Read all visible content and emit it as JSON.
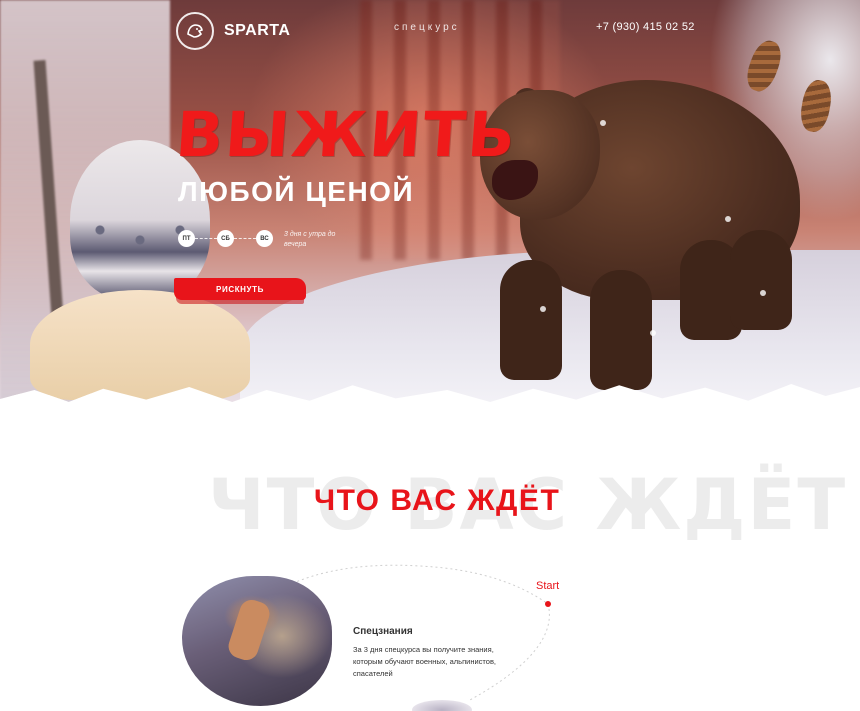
{
  "header": {
    "logo_text": "SPARTA",
    "nav_label": "спецкурс",
    "phone": "+7 (930) 415 02 52"
  },
  "hero": {
    "title": "ВЫЖИТЬ",
    "subtitle": "ЛЮБОЙ ЦЕНОЙ",
    "days": [
      "ПТ",
      "СБ",
      "ВС"
    ],
    "days_note": "3 дня с утра до вечера",
    "cta_label": "РИСКНУТЬ"
  },
  "section": {
    "ghost_title": "ЧТО ВАС ЖДЁТ",
    "title": "ЧТО ВАС ЖДЁТ",
    "start_label": "Start"
  },
  "card": {
    "title": "Спецзнания",
    "text": "За 3 дня спецкурса вы получите знания, которым обучают военных, альпинистов, спасателей"
  },
  "colors": {
    "accent": "#e8141a",
    "hero_text": "#ffffff"
  },
  "icons": {
    "logo": "bear-head-logo-icon"
  }
}
